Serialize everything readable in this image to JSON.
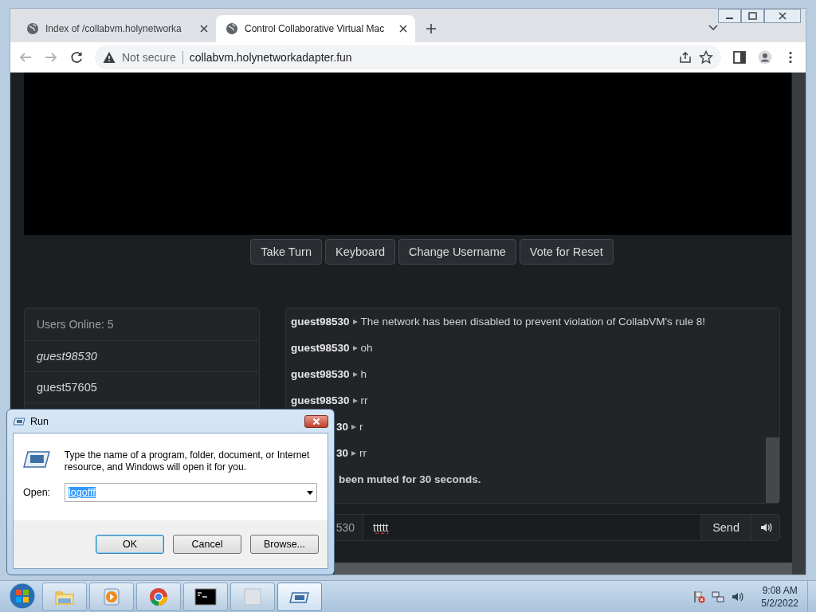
{
  "browser": {
    "tabs": [
      {
        "title": "Index of /collabvm.holynetworka",
        "selected": false
      },
      {
        "title": "Control Collaborative Virtual Mac",
        "selected": true
      }
    ],
    "address_bar": {
      "security": "Not secure",
      "url": "collabvm.holynetworkadapter.fun"
    }
  },
  "vm_controls": [
    "Take Turn",
    "Keyboard",
    "Change Username",
    "Vote for Reset"
  ],
  "users": {
    "header": "Users Online: 5",
    "items": [
      {
        "name": "guest98530",
        "current_user": true
      },
      {
        "name": "guest57605",
        "current_user": false
      }
    ]
  },
  "chat": {
    "messages": [
      {
        "kind": "message",
        "user": "guest98530",
        "text": "The network has been disabled to prevent violation of CollabVM's rule 8!"
      },
      {
        "kind": "message",
        "user": "guest98530",
        "text": "oh"
      },
      {
        "kind": "message",
        "user": "guest98530",
        "text": "h"
      },
      {
        "kind": "message",
        "user": "guest98530",
        "text": "rr"
      },
      {
        "kind": "message",
        "user": "30",
        "text": "r"
      },
      {
        "kind": "message",
        "user": "30",
        "text": "rr"
      },
      {
        "kind": "system",
        "text": "been muted for 30 seconds."
      }
    ],
    "username": "530",
    "input_value": "ttttt",
    "send": "Send"
  },
  "run_dialog": {
    "title": "Run",
    "description": "Type the name of a program, folder, document, or Internet resource, and Windows will open it for you.",
    "open_label": "Open:",
    "value": "logofff",
    "buttons": [
      {
        "label": "OK",
        "default": true
      },
      {
        "label": "Cancel",
        "default": false
      },
      {
        "label": "Browse...",
        "default": false
      }
    ]
  },
  "taskbar": {
    "items": [
      {
        "kind": "explorer",
        "active": false
      },
      {
        "kind": "media",
        "active": false
      },
      {
        "kind": "chrome",
        "active": false
      },
      {
        "kind": "terminal",
        "active": false
      },
      {
        "kind": "blank",
        "active": false
      },
      {
        "kind": "run",
        "active": true
      }
    ],
    "time": "9:08 AM",
    "date": "5/2/2022"
  }
}
